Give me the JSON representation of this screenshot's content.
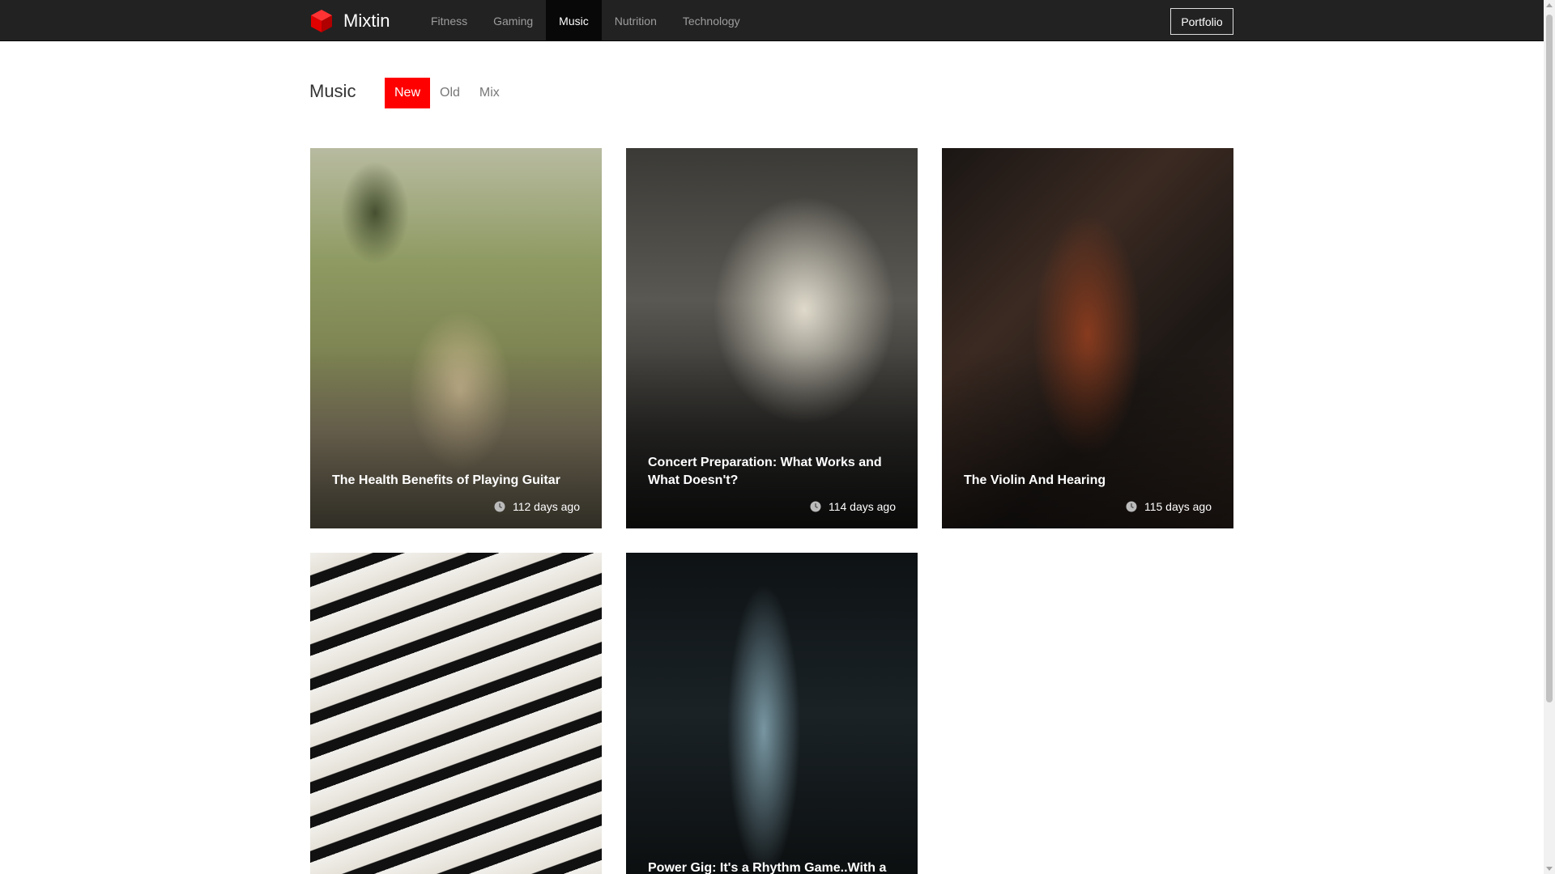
{
  "brand": {
    "name": "Mixtin",
    "logo_icon": "cube-logo-icon",
    "accent": "#ff0000"
  },
  "nav": {
    "items": [
      {
        "label": "Fitness",
        "active": false
      },
      {
        "label": "Gaming",
        "active": false
      },
      {
        "label": "Music",
        "active": true
      },
      {
        "label": "Nutrition",
        "active": false
      },
      {
        "label": "Technology",
        "active": false
      }
    ],
    "portfolio_label": "Portfolio"
  },
  "section": {
    "title": "Music",
    "filters": [
      {
        "label": "New",
        "active": true
      },
      {
        "label": "Old",
        "active": false
      },
      {
        "label": "Mix",
        "active": false
      }
    ]
  },
  "posts": [
    {
      "title": "The Health Benefits of Playing Guitar",
      "age": "112 days ago",
      "icon": "clock-icon"
    },
    {
      "title": "Concert Preparation: What Works and What Doesn't?",
      "age": "114 days ago",
      "icon": "clock-icon"
    },
    {
      "title": "The Violin And Hearing",
      "age": "115 days ago",
      "icon": "clock-icon"
    },
    {
      "title": "",
      "age": "",
      "icon": ""
    },
    {
      "title": "Power Gig: It's a Rhythm Game..With a",
      "age": "",
      "icon": ""
    }
  ]
}
